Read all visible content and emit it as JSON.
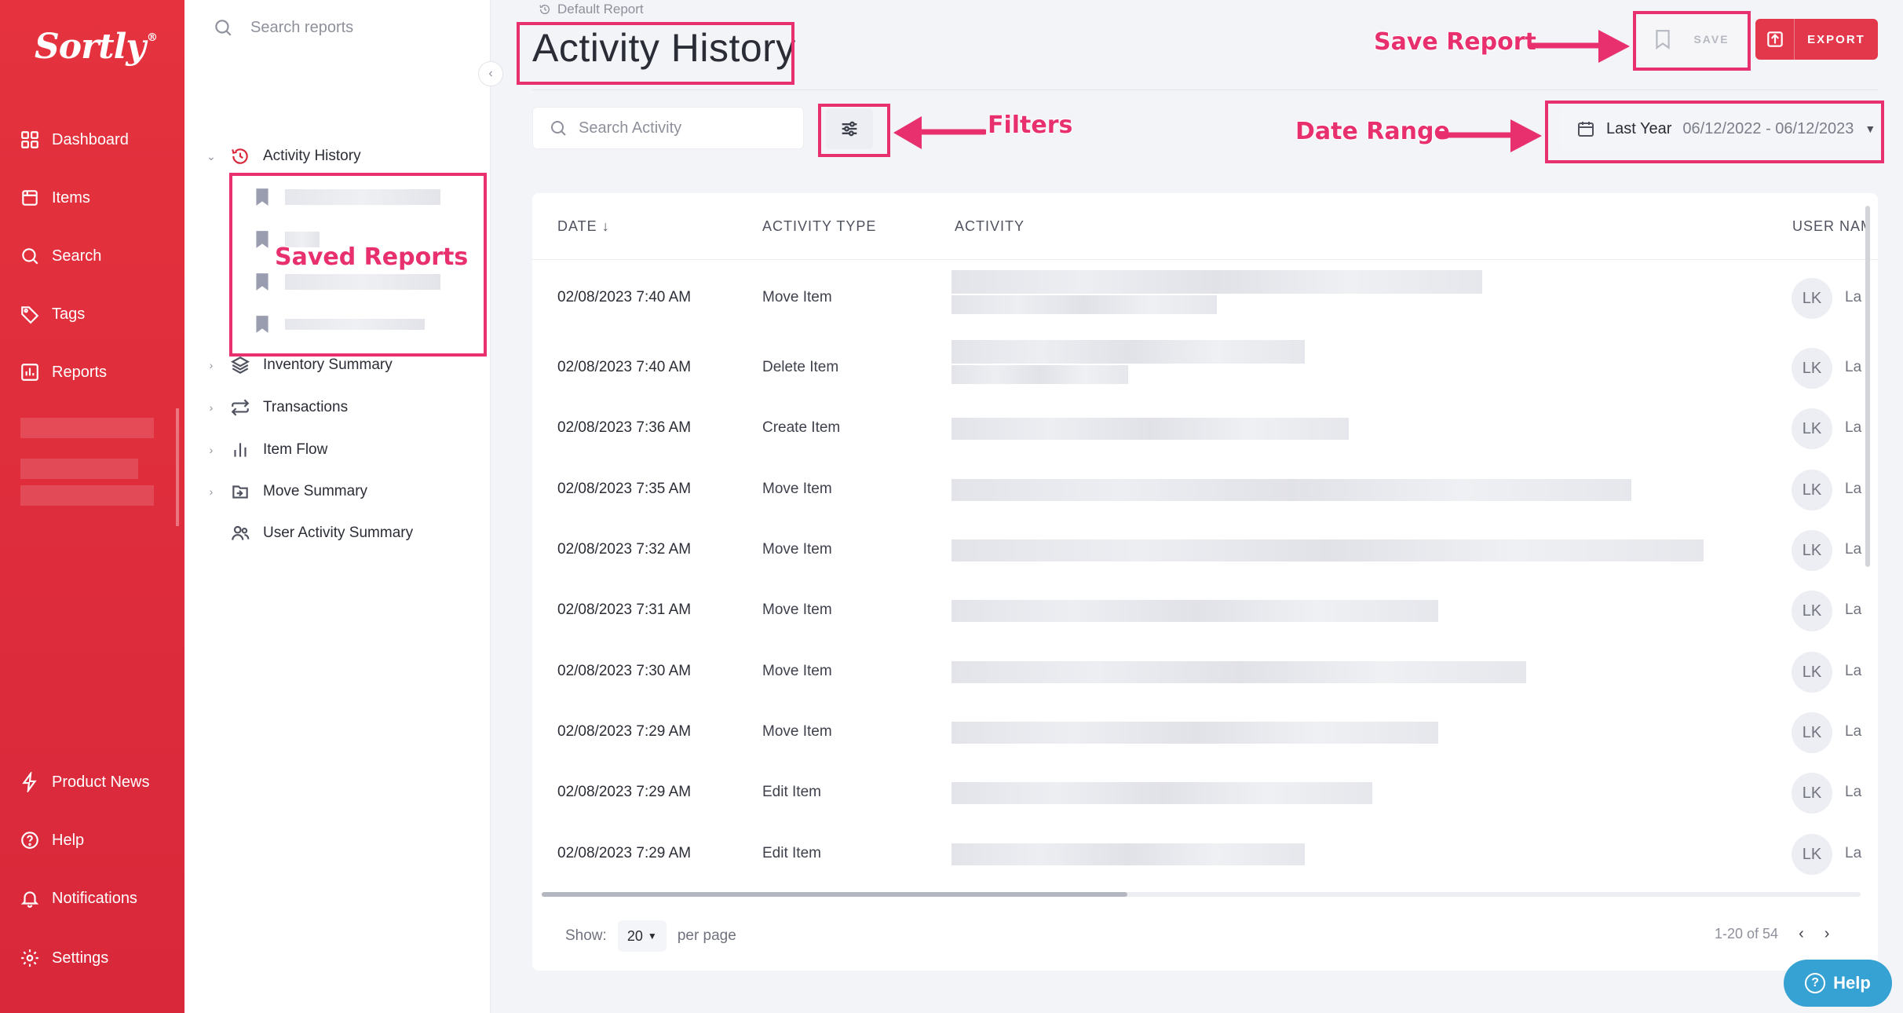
{
  "brand": {
    "logo": "Sortly",
    "registered": "®"
  },
  "sidebar": {
    "items": [
      {
        "label": "Dashboard",
        "icon": "dashboard-icon"
      },
      {
        "label": "Items",
        "icon": "items-icon"
      },
      {
        "label": "Search",
        "icon": "search-icon"
      },
      {
        "label": "Tags",
        "icon": "tag-icon"
      },
      {
        "label": "Reports",
        "icon": "reports-icon"
      }
    ],
    "bottom_items": [
      {
        "label": "Product News",
        "icon": "bolt-icon"
      },
      {
        "label": "Help",
        "icon": "help-icon"
      },
      {
        "label": "Notifications",
        "icon": "bell-icon"
      },
      {
        "label": "Settings",
        "icon": "gear-icon"
      }
    ]
  },
  "reports_panel": {
    "search_placeholder": "Search reports",
    "tree": [
      {
        "label": "Activity History",
        "icon": "history-icon",
        "expanded": true
      },
      {
        "label": "Inventory Summary",
        "icon": "layers-icon"
      },
      {
        "label": "Transactions",
        "icon": "transfer-icon"
      },
      {
        "label": "Item Flow",
        "icon": "bar-chart-icon"
      },
      {
        "label": "Move Summary",
        "icon": "move-icon"
      },
      {
        "label": "User Activity Summary",
        "icon": "users-icon"
      }
    ]
  },
  "header": {
    "breadcrumb": "Default Report",
    "title": "Activity History",
    "save_label": "SAVE",
    "export_label": "EXPORT"
  },
  "toolbar": {
    "search_placeholder": "Search Activity",
    "date_preset": "Last Year",
    "date_range": "06/12/2022 - 06/12/2023"
  },
  "table": {
    "columns": [
      "DATE",
      "ACTIVITY TYPE",
      "ACTIVITY",
      "USER NAME"
    ],
    "sort_column": "DATE",
    "rows": [
      {
        "date": "02/08/2023 7:40 AM",
        "type": "Move Item",
        "initials": "LK",
        "user": "La"
      },
      {
        "date": "02/08/2023 7:40 AM",
        "type": "Delete Item",
        "initials": "LK",
        "user": "La"
      },
      {
        "date": "02/08/2023 7:36 AM",
        "type": "Create Item",
        "initials": "LK",
        "user": "La"
      },
      {
        "date": "02/08/2023 7:35 AM",
        "type": "Move Item",
        "initials": "LK",
        "user": "La"
      },
      {
        "date": "02/08/2023 7:32 AM",
        "type": "Move Item",
        "initials": "LK",
        "user": "La"
      },
      {
        "date": "02/08/2023 7:31 AM",
        "type": "Move Item",
        "initials": "LK",
        "user": "La"
      },
      {
        "date": "02/08/2023 7:30 AM",
        "type": "Move Item",
        "initials": "LK",
        "user": "La"
      },
      {
        "date": "02/08/2023 7:29 AM",
        "type": "Move Item",
        "initials": "LK",
        "user": "La"
      },
      {
        "date": "02/08/2023 7:29 AM",
        "type": "Edit Item",
        "initials": "LK",
        "user": "La"
      },
      {
        "date": "02/08/2023 7:29 AM",
        "type": "Edit Item",
        "initials": "LK",
        "user": "La"
      }
    ]
  },
  "footer": {
    "show_label": "Show:",
    "per_page": "20",
    "per_page_label": "per page",
    "range_text": "1-20 of 54"
  },
  "help_fab": "Help",
  "annotations": {
    "save_report": "Save Report",
    "filters": "Filters",
    "date_range": "Date Range",
    "saved_reports": "Saved Reports"
  },
  "colors": {
    "brand_red": "#e5323e",
    "annotation_pink": "#e8306e",
    "help_blue": "#36a1d3"
  }
}
